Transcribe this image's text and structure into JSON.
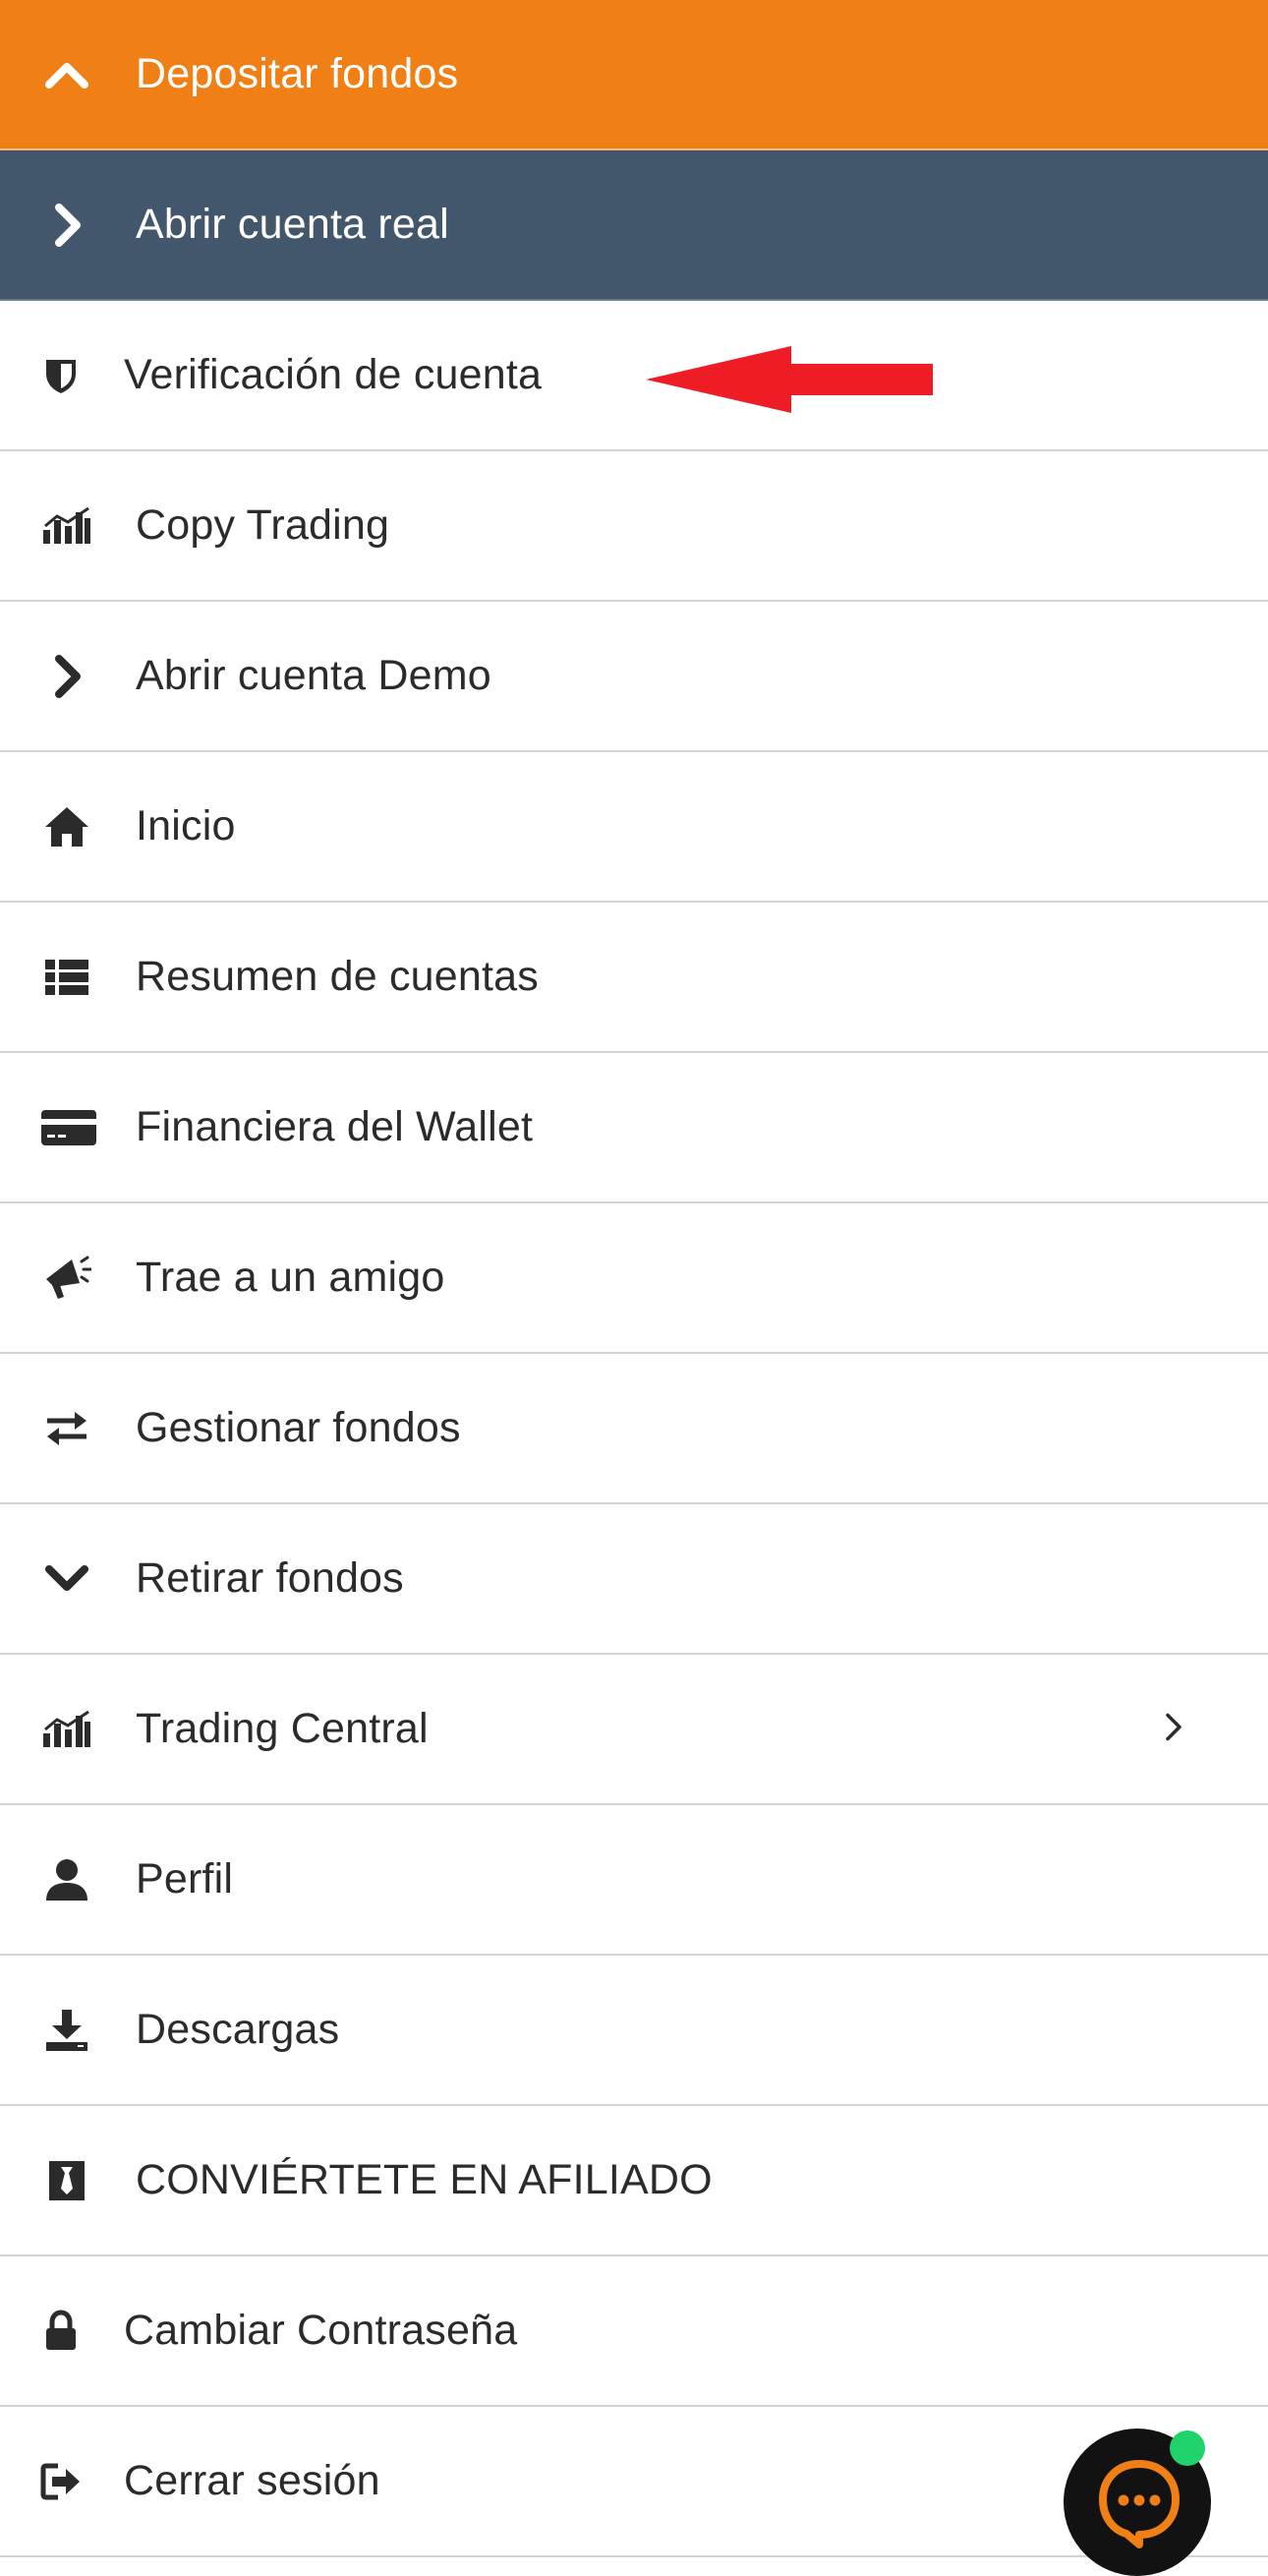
{
  "menu": {
    "items": [
      {
        "label": "Depositar fondos",
        "icon": "chevron-up-icon"
      },
      {
        "label": "Abrir cuenta real",
        "icon": "chevron-right-icon"
      },
      {
        "label": "Verificación de cuenta",
        "icon": "shield-icon"
      },
      {
        "label": "Copy Trading",
        "icon": "chart-bars-icon"
      },
      {
        "label": "Abrir cuenta Demo",
        "icon": "chevron-right-icon"
      },
      {
        "label": "Inicio",
        "icon": "home-icon"
      },
      {
        "label": "Resumen de cuentas",
        "icon": "list-icon"
      },
      {
        "label": "Financiera del Wallet",
        "icon": "credit-card-icon"
      },
      {
        "label": "Trae a un amigo",
        "icon": "megaphone-icon"
      },
      {
        "label": "Gestionar fondos",
        "icon": "transfer-arrows-icon"
      },
      {
        "label": "Retirar fondos",
        "icon": "chevron-down-icon"
      },
      {
        "label": "Trading Central",
        "icon": "chart-bars-icon"
      },
      {
        "label": "Perfil",
        "icon": "user-icon"
      },
      {
        "label": "Descargas",
        "icon": "download-icon"
      },
      {
        "label": "CONVIÉRTETE EN AFILIADO",
        "icon": "badge-tie-icon"
      },
      {
        "label": "Cambiar Contraseña",
        "icon": "lock-icon"
      },
      {
        "label": "Cerrar sesión",
        "icon": "logout-icon"
      }
    ]
  },
  "colors": {
    "primary": "#f07f16",
    "secondary": "#42576b",
    "text": "#2b2b2b",
    "annotation_arrow": "#ee1c25",
    "chat_background": "#121212",
    "chat_accent": "#f07f16",
    "online": "#1fd36a"
  },
  "chat": {
    "icon": "chat-bubble-icon",
    "status_icon": "online-dot-icon"
  }
}
